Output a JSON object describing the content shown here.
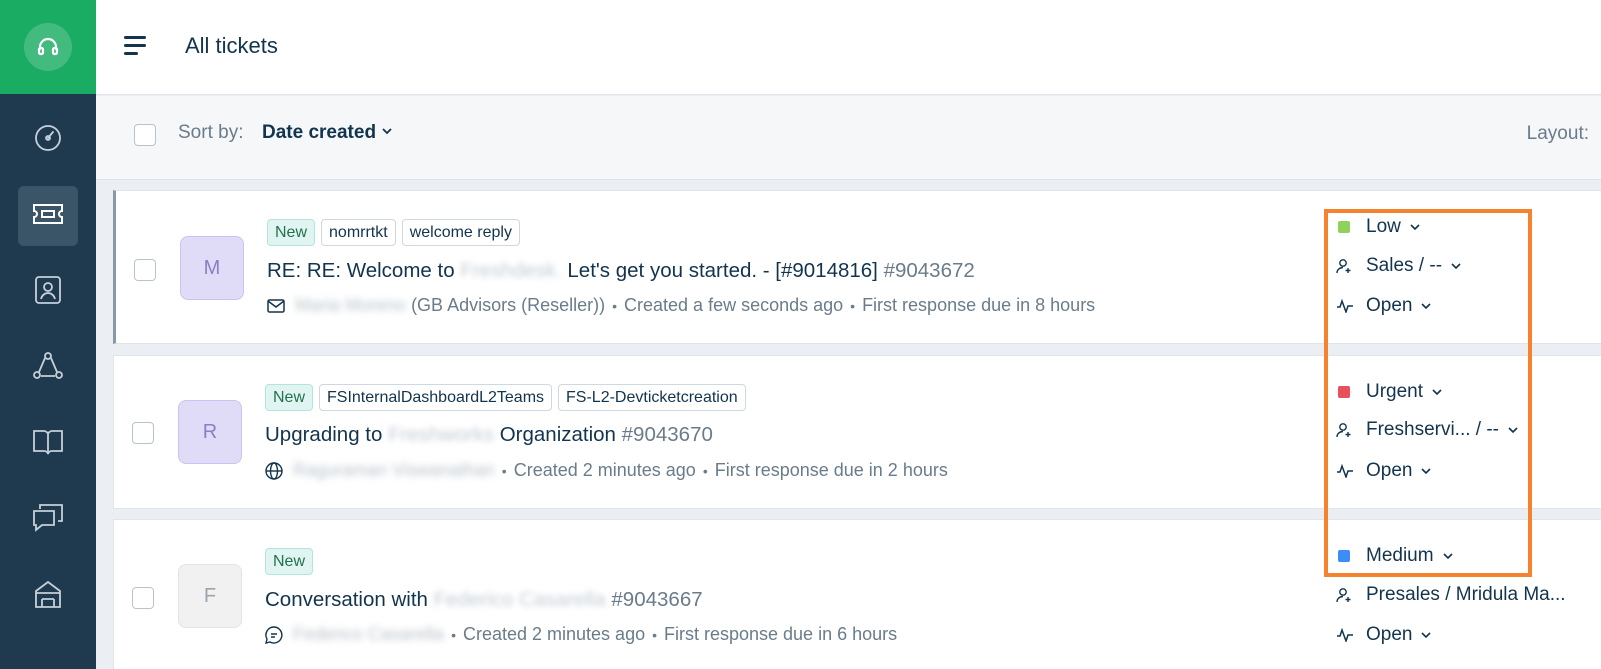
{
  "header": {
    "title": "All tickets"
  },
  "sortbar": {
    "sort_label": "Sort by:",
    "sort_value": "Date created",
    "layout_label": "Layout:"
  },
  "sidebar": {
    "items": [
      {
        "icon": "dashboard-icon"
      },
      {
        "icon": "tickets-icon",
        "active": true
      },
      {
        "icon": "contacts-icon"
      },
      {
        "icon": "groups-icon"
      },
      {
        "icon": "knowledge-base-icon"
      },
      {
        "icon": "discussions-icon"
      },
      {
        "icon": "admin-icon"
      }
    ]
  },
  "tickets": [
    {
      "avatar": "M",
      "tags": [
        "New",
        "nomrrtkt",
        "welcome reply"
      ],
      "subject_pre": "RE: RE: Welcome to ",
      "subject_blur": "Freshdesk.",
      "subject_post": " Let's get you started. - [#9014816] ",
      "ticket_id": "#9043672",
      "requester": "Maria Moreno",
      "company": "(GB Advisors (Reseller))",
      "created": "Created a few seconds ago",
      "due": "First response due in 8 hours",
      "channel_icon": "email-icon",
      "priority": "Low",
      "priority_color": "#8ed25d",
      "assignee": "Sales / --",
      "status": "Open"
    },
    {
      "avatar": "R",
      "tags": [
        "New",
        "FSInternalDashboardL2Teams",
        "FS-L2-Devticketcreation"
      ],
      "subject_pre": "Upgrading to ",
      "subject_blur": "Freshworks",
      "subject_post": " Organization ",
      "ticket_id": "#9043670",
      "requester": "Raguraman Viswanathan",
      "company": "",
      "created": "Created 2 minutes ago",
      "due": "First response due in 2 hours",
      "channel_icon": "globe-icon",
      "priority": "Urgent",
      "priority_color": "#e8505b",
      "assignee": "Freshservi... / --",
      "status": "Open"
    },
    {
      "avatar": "F",
      "tags": [
        "New"
      ],
      "subject_pre": "Conversation with ",
      "subject_blur": "Federico Casarella",
      "subject_post": " ",
      "ticket_id": "#9043667",
      "requester": "Federico Casarella",
      "company": "",
      "created": "Created 2 minutes ago",
      "due": "First response due in 6 hours",
      "channel_icon": "chat-icon",
      "priority": "Medium",
      "priority_color": "#3c8df5",
      "assignee": "Presales / Mridula Ma...",
      "status": "Open"
    }
  ],
  "colors": {
    "sidebar": "#1f3a4e",
    "brand": "#1aac62",
    "highlight": "#f5832d"
  }
}
